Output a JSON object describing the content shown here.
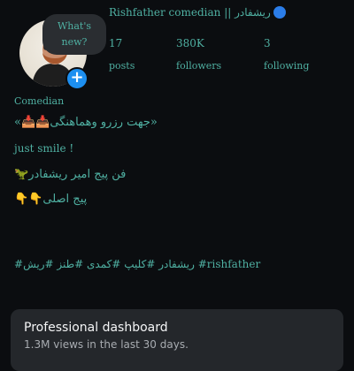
{
  "note": {
    "line1": "What's",
    "line2": "new?"
  },
  "profile": {
    "display_name": "Rishfather comedian || ریشفادر",
    "category": "Comedian"
  },
  "stats": [
    {
      "value": "17",
      "label": "posts"
    },
    {
      "value": "380K",
      "label": "followers"
    },
    {
      "value": "3",
      "label": "following"
    }
  ],
  "bio": {
    "line1": "«📥📥جهت رزرو وهماهنگی»",
    "line2": "just smile !",
    "line3": "🦖فن پیج امیر ریشفادر",
    "line4": "👇👇پیج اصلی",
    "hashtags": "#ریشفادر #کلیپ #کمدی #طنز #ریش #rishfather"
  },
  "dashboard": {
    "title": "Professional dashboard",
    "subtitle": "1.3M views in the last 30 days."
  },
  "colors": {
    "background": "#0b0d10",
    "text_accent": "#4fb0a2",
    "badge_blue": "#1d8ff0",
    "card": "#24272b"
  },
  "icons": {
    "avatar_badge": "plus-icon",
    "verified_dot": "blue-circle-icon"
  }
}
